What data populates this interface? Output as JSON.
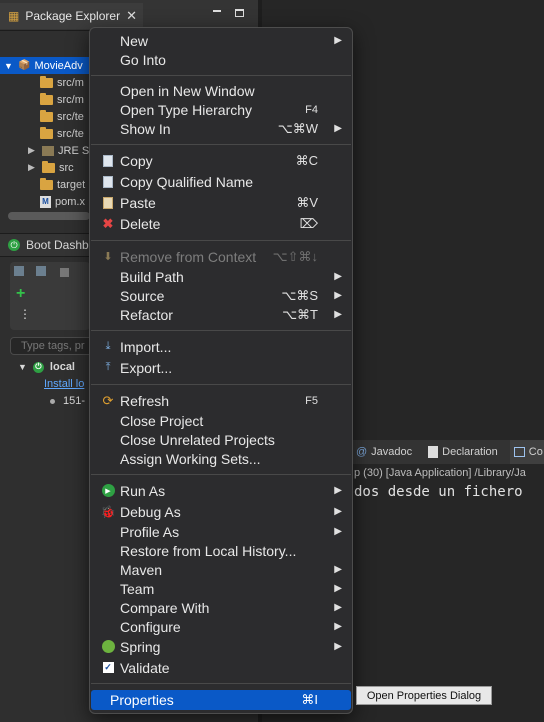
{
  "explorer": {
    "tab_label": "Package Explorer",
    "items": [
      {
        "label": "MovieAdv"
      },
      {
        "label": "src/m"
      },
      {
        "label": "src/m"
      },
      {
        "label": "src/te"
      },
      {
        "label": "src/te"
      },
      {
        "label": "JRE S"
      },
      {
        "label": "src"
      },
      {
        "label": "target"
      },
      {
        "label": "pom.x"
      }
    ]
  },
  "boot": {
    "title": "Boot Dashb",
    "filter_placeholder": "Type tags, pr",
    "local_label": "local",
    "install_link": "Install lo",
    "process": "151-"
  },
  "console": {
    "tabs": [
      "Javadoc",
      "Declaration",
      "Co"
    ],
    "header": "p (30) [Java Application] /Library/Ja",
    "output": "dos desde un fichero"
  },
  "menu": {
    "items": [
      {
        "label": "New",
        "shortcut": "",
        "submenu": true
      },
      {
        "label": "Go Into",
        "shortcut": "",
        "submenu": false
      },
      {
        "label": "Open in New Window",
        "shortcut": "",
        "submenu": false
      },
      {
        "label": "Open Type Hierarchy",
        "shortcut": "F4",
        "submenu": false
      },
      {
        "label": "Show In",
        "shortcut": "⌥⌘W",
        "submenu": true
      },
      {
        "label": "Copy",
        "shortcut": "⌘C",
        "submenu": false
      },
      {
        "label": "Copy Qualified Name",
        "shortcut": "",
        "submenu": false
      },
      {
        "label": "Paste",
        "shortcut": "⌘V",
        "submenu": false
      },
      {
        "label": "Delete",
        "shortcut": "⌦",
        "submenu": false
      },
      {
        "label": "Remove from Context",
        "shortcut": "⌥⇧⌘↓",
        "submenu": false
      },
      {
        "label": "Build Path",
        "shortcut": "",
        "submenu": true
      },
      {
        "label": "Source",
        "shortcut": "⌥⌘S",
        "submenu": true
      },
      {
        "label": "Refactor",
        "shortcut": "⌥⌘T",
        "submenu": true
      },
      {
        "label": "Import...",
        "shortcut": "",
        "submenu": false
      },
      {
        "label": "Export...",
        "shortcut": "",
        "submenu": false
      },
      {
        "label": "Refresh",
        "shortcut": "F5",
        "submenu": false
      },
      {
        "label": "Close Project",
        "shortcut": "",
        "submenu": false
      },
      {
        "label": "Close Unrelated Projects",
        "shortcut": "",
        "submenu": false
      },
      {
        "label": "Assign Working Sets...",
        "shortcut": "",
        "submenu": false
      },
      {
        "label": "Run As",
        "shortcut": "",
        "submenu": true
      },
      {
        "label": "Debug As",
        "shortcut": "",
        "submenu": true
      },
      {
        "label": "Profile As",
        "shortcut": "",
        "submenu": true
      },
      {
        "label": "Restore from Local History...",
        "shortcut": "",
        "submenu": false
      },
      {
        "label": "Maven",
        "shortcut": "",
        "submenu": true
      },
      {
        "label": "Team",
        "shortcut": "",
        "submenu": true
      },
      {
        "label": "Compare With",
        "shortcut": "",
        "submenu": true
      },
      {
        "label": "Configure",
        "shortcut": "",
        "submenu": true
      },
      {
        "label": "Spring",
        "shortcut": "",
        "submenu": true
      },
      {
        "label": "Validate",
        "shortcut": "",
        "submenu": false
      },
      {
        "label": "Properties",
        "shortcut": "⌘I",
        "submenu": false
      }
    ]
  },
  "tooltip": "Open Properties Dialog",
  "colors": {
    "selection": "#0a59c7",
    "menu_bg": "#2c2c2e"
  }
}
